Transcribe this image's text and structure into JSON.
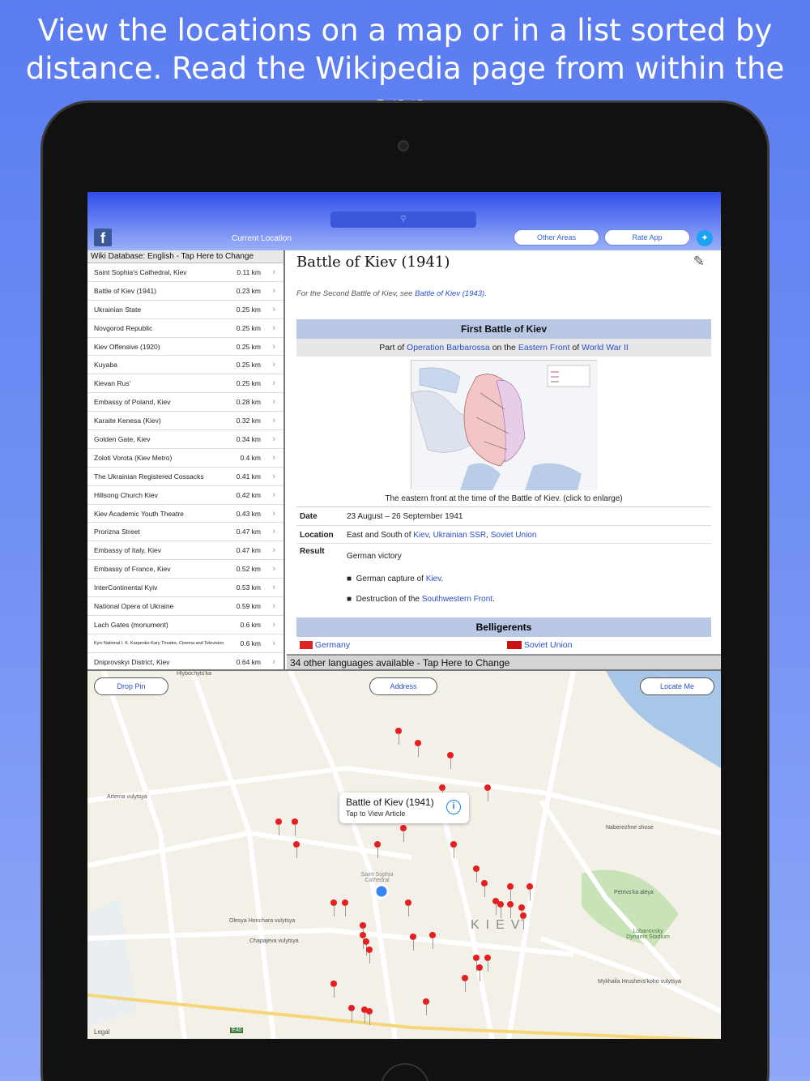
{
  "caption": "View the locations on a map or in a list sorted by distance. Read the Wikipedia page from within the app.",
  "topbar": {
    "title": "Current Location",
    "other_areas": "Other Areas",
    "rate_app": "Rate App",
    "facebook": "f"
  },
  "list": {
    "header": "Wiki Database: English - Tap Here to Change",
    "rows": [
      {
        "name": "Saint Sophia's Cathedral, Kiev",
        "dist": "0.11 km"
      },
      {
        "name": "Battle of Kiev (1941)",
        "dist": "0.23 km"
      },
      {
        "name": "Ukrainian State",
        "dist": "0.25 km"
      },
      {
        "name": "Novgorod Republic",
        "dist": "0.25 km"
      },
      {
        "name": "Kiev Offensive (1920)",
        "dist": "0.25 km"
      },
      {
        "name": "Kuyaba",
        "dist": "0.25 km"
      },
      {
        "name": "Kievan Rus'",
        "dist": "0.25 km"
      },
      {
        "name": "Embassy of Poland, Kiev",
        "dist": "0.28 km"
      },
      {
        "name": "Karaite Kenesa (Kiev)",
        "dist": "0.32 km"
      },
      {
        "name": "Golden Gate, Kiev",
        "dist": "0.34 km"
      },
      {
        "name": "Zoloti Vorota (Kiev Metro)",
        "dist": "0.4 km"
      },
      {
        "name": "The Ukrainian Registered Cossacks",
        "dist": "0.41 km"
      },
      {
        "name": "Hillsong Church Kiev",
        "dist": "0.42 km"
      },
      {
        "name": "Kiev Academic Youth Theatre",
        "dist": "0.43 km"
      },
      {
        "name": "Prorizna Street",
        "dist": "0.47 km"
      },
      {
        "name": "Embassy of Italy, Kiev",
        "dist": "0.47 km"
      },
      {
        "name": "Embassy of France, Kiev",
        "dist": "0.52 km"
      },
      {
        "name": "InterContinental Kyiv",
        "dist": "0.53 km"
      },
      {
        "name": "National Opera of Ukraine",
        "dist": "0.59 km"
      },
      {
        "name": "Lach Gates (monument)",
        "dist": "0.6 km"
      },
      {
        "name": "Kyiv National I. K. Karpenko-Kary Theatre, Cinema and Television Unive...",
        "dist": "0.6 km"
      },
      {
        "name": "Dniprovskyi District, Kiev",
        "dist": "0.64 km"
      }
    ]
  },
  "article": {
    "title": "Battle of Kiev (1941)",
    "hatnote_prefix": "For the Second Battle of Kiev, see ",
    "hatnote_link": "Battle of Kiev (1943)",
    "hatnote_suffix": ".",
    "infobox_title": "First Battle of Kiev",
    "sub_part_of": "Part of ",
    "sub_link1": "Operation Barbarossa",
    "sub_on": " on the ",
    "sub_link2": "Eastern Front",
    "sub_of": " of ",
    "sub_link3": "World War II",
    "map_caption": "The eastern front at the time of the Battle of Kiev. (click to enlarge)",
    "date_label": "Date",
    "date_value": "23 August – 26 September 1941",
    "location_label": "Location",
    "location_prefix": "East and South of ",
    "location_link1": "Kiev",
    "location_link2": "Ukrainian SSR",
    "location_link3": "Soviet Union",
    "result_label": "Result",
    "result_value": "German victory",
    "result_b1_prefix": "German capture of ",
    "result_b1_link": "Kiev",
    "result_b2_prefix": "Destruction of the ",
    "result_b2_link": "Southwestern Front",
    "belligerents": "Belligerents",
    "bel1": "Germany",
    "bel2": "Soviet Union",
    "languages_bar": "34 other languages available - Tap Here to Change"
  },
  "map": {
    "drop_pin": "Drop Pin",
    "address": "Address",
    "locate_me": "Locate Me",
    "callout_title": "Battle of Kiev (1941)",
    "callout_sub": "Tap to View Article",
    "legal": "Legal",
    "kiev_label": "KIEV",
    "saint_sophia": "Saint Sophia Cathedral",
    "stadium": "Lobanovsky Dynamo Stadium",
    "e40": "E40",
    "streets": [
      "Artema vulytsya",
      "Olesya Honchara vulytsya",
      "Chapajeva vulytsya",
      "Naberezhne shose",
      "Petrivs'ka aleya",
      "Mykhaila Hrushevs'koho vulytsya",
      "Hlybochyts'ka"
    ]
  },
  "colors": {
    "accent": "#2a4fc8",
    "pin": "#e61e1e",
    "bg": "#6f8ff4"
  }
}
